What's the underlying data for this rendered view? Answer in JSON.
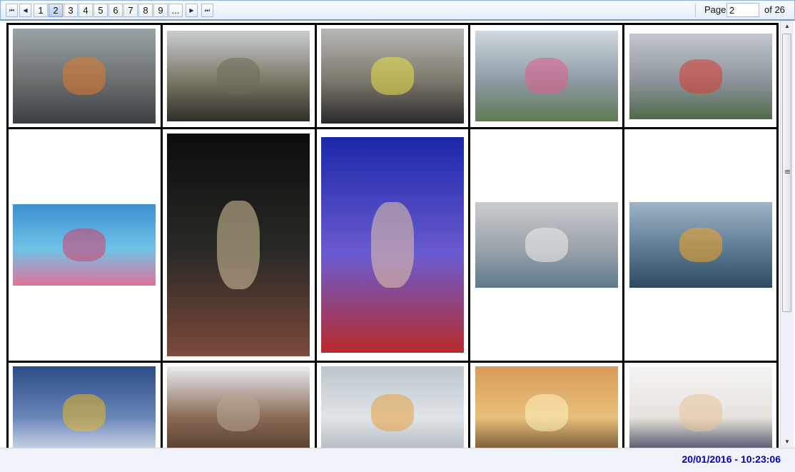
{
  "pager": {
    "first_glyph": "⏮",
    "prev_glyph": "◀",
    "next_glyph": "▶",
    "last_glyph": "⏭",
    "pages": [
      "1",
      "2",
      "3",
      "4",
      "5",
      "6",
      "7",
      "8",
      "9",
      "..."
    ],
    "current_page": "2",
    "page_label": "Page",
    "page_value": "2",
    "of_label": "of 26"
  },
  "gallery": {
    "rows": [
      [
        {
          "name": "thumb-street-crash-rescue",
          "colors": [
            "#9aa3a6",
            "#6b6f70",
            "#3c3f41"
          ],
          "accent": "#e07a2c"
        },
        {
          "name": "thumb-soldiers-truck",
          "colors": [
            "#c9cdd0",
            "#7c7866",
            "#2f2d28"
          ],
          "accent": "#6b6b55"
        },
        {
          "name": "thumb-market-street-police",
          "colors": [
            "#b7b8b4",
            "#7d776c",
            "#2a2a2a"
          ],
          "accent": "#e8e34a"
        },
        {
          "name": "thumb-town-lane",
          "colors": [
            "#cfd8de",
            "#8e9aa5",
            "#5f7b52"
          ],
          "accent": "#e05c8a"
        },
        {
          "name": "thumb-highway-traffic",
          "colors": [
            "#c3c8cf",
            "#8d949c",
            "#4f6a4a"
          ],
          "accent": "#d83a2c"
        }
      ],
      [
        {
          "name": "thumb-flower-dancers",
          "colors": [
            "#3a8fcf",
            "#6fc3e6",
            "#e2729a"
          ],
          "accent": "#d63c6a"
        },
        {
          "name": "thumb-guitarist-concert",
          "colors": [
            "#0c0c0c",
            "#2c2a26",
            "#7c4a3a"
          ],
          "accent": "#d8c8a0"
        },
        {
          "name": "thumb-singer-microphone",
          "colors": [
            "#1a28a8",
            "#6b5bd0",
            "#b82a2a"
          ],
          "accent": "#e8c8a8"
        },
        {
          "name": "thumb-industrial-plant",
          "colors": [
            "#c8ccd0",
            "#9aa2a8",
            "#5d7a8a"
          ],
          "accent": "#f0f0f0"
        },
        {
          "name": "thumb-oil-rig-flare",
          "colors": [
            "#9eb4c8",
            "#5c7a92",
            "#2e4a60"
          ],
          "accent": "#f5a623"
        }
      ],
      [
        {
          "name": "thumb-snow-parliament-loader",
          "colors": [
            "#2a4c88",
            "#6a86b8",
            "#e6ecf2"
          ],
          "accent": "#e8b826"
        },
        {
          "name": "thumb-monkeys-snow",
          "colors": [
            "#e8ecf0",
            "#8a6a54",
            "#4a3424"
          ],
          "accent": "#b8a898"
        },
        {
          "name": "thumb-castle-crane",
          "colors": [
            "#bcc6cc",
            "#dfe4e8",
            "#a8b2b8"
          ],
          "accent": "#e8a040"
        },
        {
          "name": "thumb-sunset-reeds",
          "colors": [
            "#d89a5a",
            "#e8c07a",
            "#5a3c24"
          ],
          "accent": "#fff2c0"
        },
        {
          "name": "thumb-speaker-podium",
          "colors": [
            "#f4f4f4",
            "#e8e2dc",
            "#24304a"
          ],
          "accent": "#e8c29a"
        }
      ]
    ]
  },
  "status": {
    "datetime": "20/01/2016 - 10:23:06"
  }
}
